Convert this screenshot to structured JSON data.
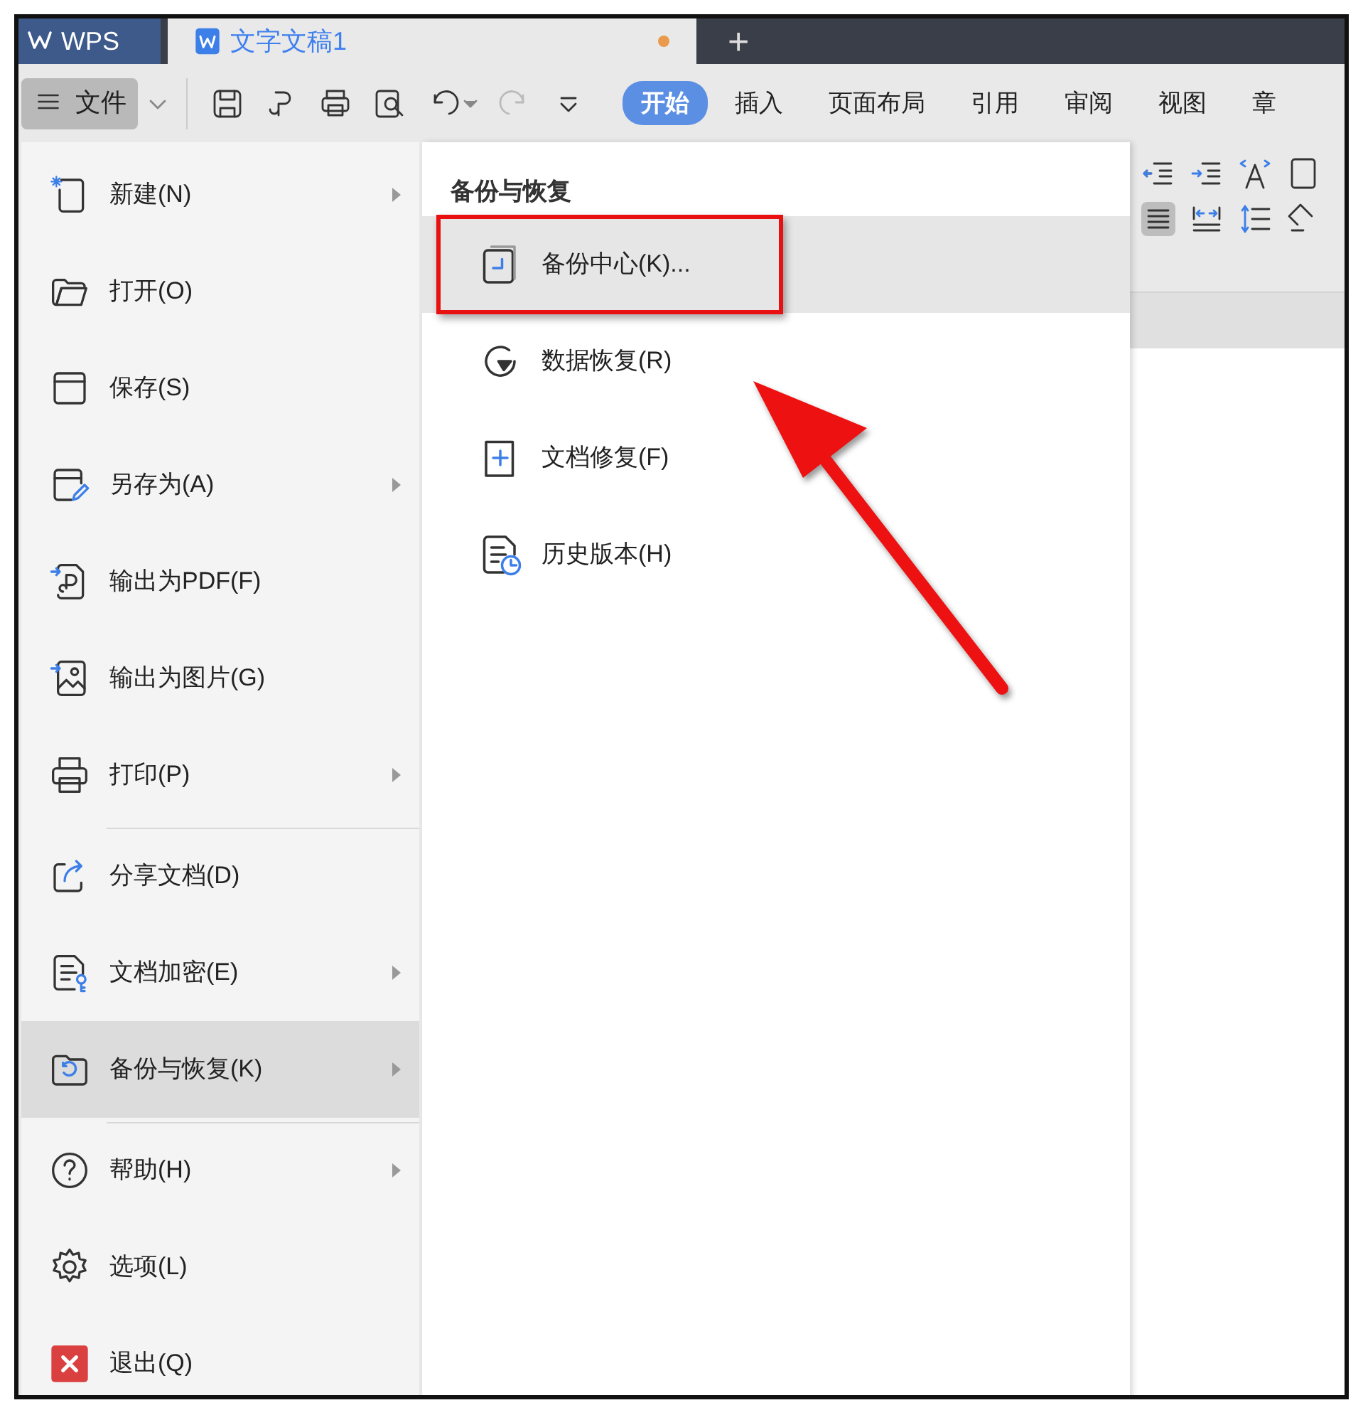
{
  "app_tab": {
    "label": "WPS"
  },
  "doc_tab": {
    "label": "文字文稿1",
    "unsaved": true
  },
  "new_tab": {
    "label": "+"
  },
  "file_menu_button": {
    "label": "文件",
    "selected": true
  },
  "ribbon_tabs": [
    {
      "label": "开始",
      "selected": true
    },
    {
      "label": "插入",
      "selected": false
    },
    {
      "label": "页面布局",
      "selected": false
    },
    {
      "label": "引用",
      "selected": false
    },
    {
      "label": "审阅",
      "selected": false
    },
    {
      "label": "视图",
      "selected": false
    },
    {
      "label": "章",
      "selected": false
    }
  ],
  "file_menu": [
    {
      "label": "新建(N)",
      "submenu": true,
      "selected": false,
      "separator_above": false
    },
    {
      "label": "打开(O)",
      "submenu": false,
      "selected": false,
      "separator_above": false
    },
    {
      "label": "保存(S)",
      "submenu": false,
      "selected": false,
      "separator_above": false
    },
    {
      "label": "另存为(A)",
      "submenu": true,
      "selected": false,
      "separator_above": false
    },
    {
      "label": "输出为PDF(F)",
      "submenu": false,
      "selected": false,
      "separator_above": false
    },
    {
      "label": "输出为图片(G)",
      "submenu": false,
      "selected": false,
      "separator_above": false
    },
    {
      "label": "打印(P)",
      "submenu": true,
      "selected": false,
      "separator_above": false
    },
    {
      "label": "分享文档(D)",
      "submenu": false,
      "selected": false,
      "separator_above": true
    },
    {
      "label": "文档加密(E)",
      "submenu": true,
      "selected": false,
      "separator_above": false
    },
    {
      "label": "备份与恢复(K)",
      "submenu": true,
      "selected": true,
      "separator_above": false
    },
    {
      "label": "帮助(H)",
      "submenu": true,
      "selected": false,
      "separator_above": true
    },
    {
      "label": "选项(L)",
      "submenu": false,
      "selected": false,
      "separator_above": false
    },
    {
      "label": "退出(Q)",
      "submenu": false,
      "selected": false,
      "separator_above": false
    }
  ],
  "submenu": {
    "title": "备份与恢复",
    "items": [
      {
        "label": "备份中心(K)...",
        "selected": true,
        "highlighted": true
      },
      {
        "label": "数据恢复(R)",
        "selected": false,
        "highlighted": false
      },
      {
        "label": "文档修复(F)",
        "selected": false,
        "highlighted": false
      },
      {
        "label": "历史版本(H)",
        "selected": false,
        "highlighted": false
      }
    ],
    "pointer_arrow": true
  }
}
